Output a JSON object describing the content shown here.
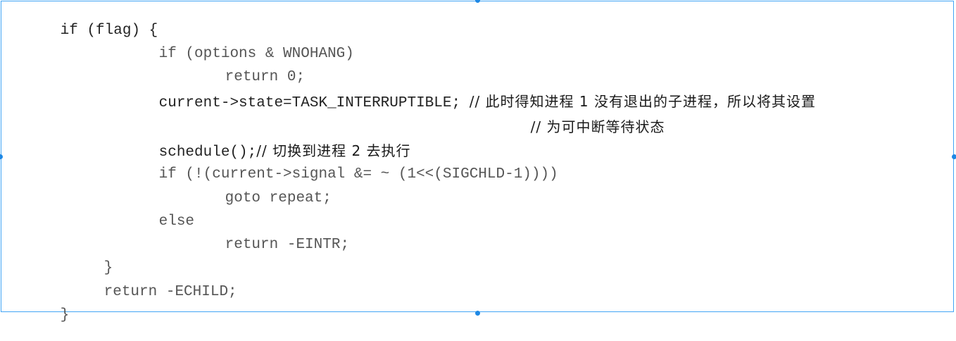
{
  "code": {
    "lines": [
      {
        "text": "if (flag) {",
        "dark": true
      },
      {
        "text": "if (options & WNOHANG)",
        "dark": false
      },
      {
        "text": "return 0;",
        "dark": false
      },
      {
        "text": "current->state=TASK_INTERRUPTIBLE; ",
        "comment": "// 此时得知进程 1 没有退出的子进程，所以将其设置",
        "dark": true
      },
      {
        "text": "",
        "comment": "// 为可中断等待状态",
        "dark": true
      },
      {
        "text": "schedule();",
        "comment": "// 切换到进程 2 去执行",
        "dark": true
      },
      {
        "text": "if (!(current->signal &= ~ (1<<(SIGCHLD-1))))",
        "dark": false
      },
      {
        "text": "goto repeat;",
        "dark": false
      },
      {
        "text": "else",
        "dark": false
      },
      {
        "text": "return -EINTR;",
        "dark": false
      },
      {
        "text": "}",
        "dark": false
      },
      {
        "text": "return -ECHILD;",
        "dark": false
      },
      {
        "text": "}",
        "dark": false
      }
    ]
  },
  "selection_handles": [
    "top-center-handle",
    "bottom-center-handle",
    "left-middle-handle",
    "right-middle-handle"
  ]
}
